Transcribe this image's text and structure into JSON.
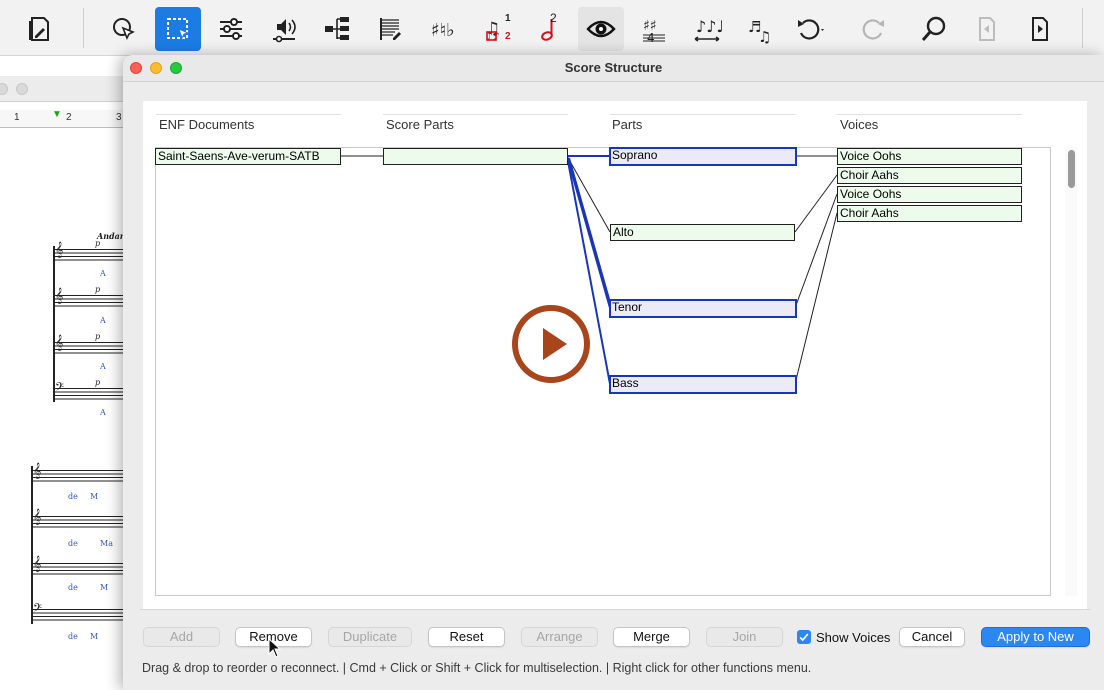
{
  "dialog": {
    "title": "Score Structure",
    "columns": {
      "enf_documents": "ENF Documents",
      "score_parts": "Score Parts",
      "parts": "Parts",
      "voices": "Voices"
    },
    "enf_documents": [
      "Saint-Saens-Ave-verum-SATB"
    ],
    "score_parts": [
      ""
    ],
    "parts": [
      {
        "label": "Soprano",
        "selected": true
      },
      {
        "label": "Alto",
        "selected": false
      },
      {
        "label": "Tenor",
        "selected": true
      },
      {
        "label": "Bass",
        "selected": true
      }
    ],
    "voices": [
      "Voice Oohs",
      "Choir Aahs",
      "Voice Oohs",
      "Choir Aahs"
    ],
    "buttons": {
      "add": "Add",
      "remove": "Remove",
      "duplicate": "Duplicate",
      "reset": "Reset",
      "arrange": "Arrange",
      "merge": "Merge",
      "join": "Join",
      "cancel": "Cancel",
      "apply": "Apply to New"
    },
    "show_voices": {
      "label": "Show Voices",
      "checked": true
    },
    "status_text": "Drag & drop to reorder o reconnect. | Cmd + Click or Shift + Click for multiselection. | Right click for other functions menu."
  },
  "toolbar": {
    "selected_tool": "selection-tool",
    "badge_1": "1",
    "badge_2": "2",
    "badge_note_2": "2"
  },
  "background_score": {
    "ruler": [
      "1",
      "2",
      "3"
    ],
    "tempo": "Andant",
    "dynamic": "p",
    "lyric_a": "A",
    "lyric_de": "de",
    "lyric_m": "M",
    "lyric_ma": "Ma"
  },
  "colors": {
    "accent": "#2a87f4",
    "node_fill": "#ecfbec",
    "selected_fill": "#ebebf8",
    "selected_border": "#1936b7",
    "play_icon": "#a8451b",
    "red_icon": "#d0121b"
  }
}
